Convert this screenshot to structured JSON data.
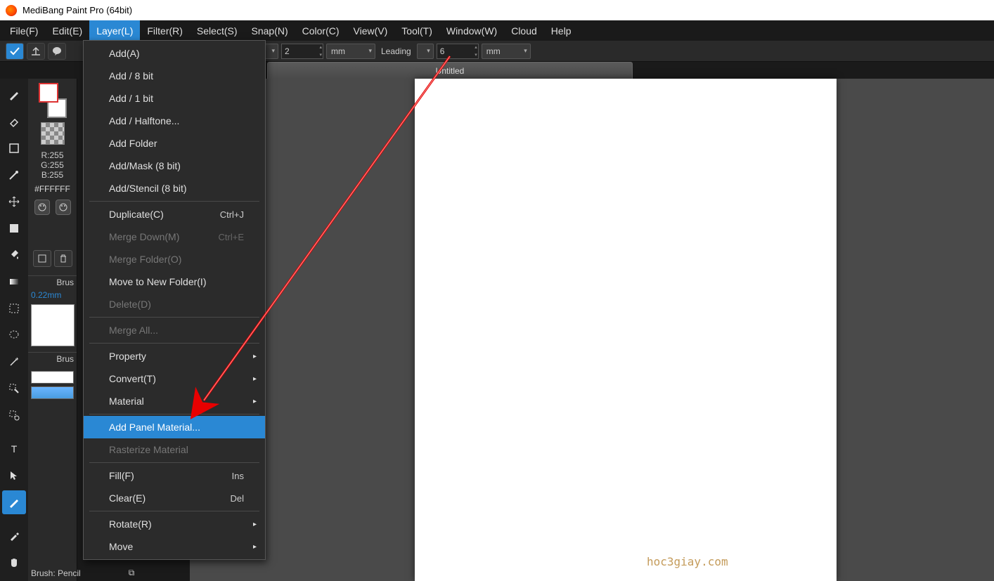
{
  "title": "MediBang Paint Pro (64bit)",
  "menubar": [
    "File(F)",
    "Edit(E)",
    "Layer(L)",
    "Filter(R)",
    "Select(S)",
    "Snap(N)",
    "Color(C)",
    "View(V)",
    "Tool(T)",
    "Window(W)",
    "Cloud",
    "Help"
  ],
  "options": {
    "val1": "2",
    "unit1": "mm",
    "leading_label": "Leading",
    "val2": "6",
    "unit2": "mm"
  },
  "tab_title": "Untitled",
  "color": {
    "r": "R:255",
    "g": "G:255",
    "b": "B:255",
    "hex": "#FFFFFF"
  },
  "brush_panel_label1": "Brus",
  "brush_size": "0.22mm",
  "brush_panel_label2": "Brus",
  "brush_footer": "Brush: Pencil",
  "dropdown": [
    {
      "label": "Add(A)",
      "type": "item"
    },
    {
      "label": "Add / 8 bit",
      "type": "item"
    },
    {
      "label": "Add / 1 bit",
      "type": "item"
    },
    {
      "label": "Add / Halftone...",
      "type": "item"
    },
    {
      "label": "Add Folder",
      "type": "item"
    },
    {
      "label": "Add/Mask (8 bit)",
      "type": "item"
    },
    {
      "label": "Add/Stencil (8 bit)",
      "type": "item"
    },
    {
      "type": "sep"
    },
    {
      "label": "Duplicate(C)",
      "shortcut": "Ctrl+J",
      "type": "item"
    },
    {
      "label": "Merge Down(M)",
      "shortcut": "Ctrl+E",
      "type": "item",
      "disabled": true
    },
    {
      "label": "Merge Folder(O)",
      "type": "item",
      "disabled": true
    },
    {
      "label": "Move to New Folder(I)",
      "type": "item"
    },
    {
      "label": "Delete(D)",
      "type": "item",
      "disabled": true
    },
    {
      "type": "sep"
    },
    {
      "label": "Merge All...",
      "type": "item",
      "disabled": true
    },
    {
      "type": "sep"
    },
    {
      "label": "Property",
      "type": "item",
      "sub": true
    },
    {
      "label": "Convert(T)",
      "type": "item",
      "sub": true
    },
    {
      "label": "Material",
      "type": "item",
      "sub": true
    },
    {
      "type": "sep"
    },
    {
      "label": "Add Panel Material...",
      "type": "item",
      "highlighted": true
    },
    {
      "label": "Rasterize Material",
      "type": "item",
      "disabled": true
    },
    {
      "type": "sep"
    },
    {
      "label": "Fill(F)",
      "shortcut": "Ins",
      "type": "item"
    },
    {
      "label": "Clear(E)",
      "shortcut": "Del",
      "type": "item"
    },
    {
      "type": "sep"
    },
    {
      "label": "Rotate(R)",
      "type": "item",
      "sub": true
    },
    {
      "label": "Move",
      "type": "item",
      "sub": true
    }
  ],
  "watermark": "hoc3giay.com"
}
